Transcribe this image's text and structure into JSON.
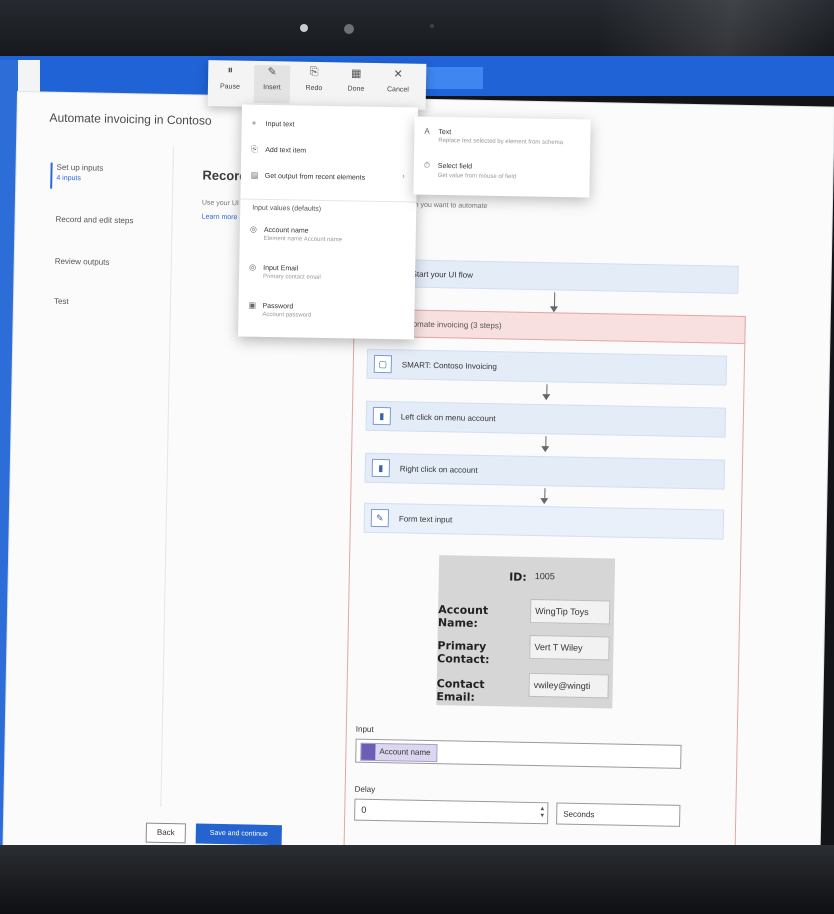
{
  "app": {
    "title": "Automate invoicing in Contoso"
  },
  "steps": [
    {
      "label": "Set up inputs",
      "sub": "4 inputs"
    },
    {
      "label": "Record and edit steps",
      "sub": ""
    },
    {
      "label": "Review outputs",
      "sub": ""
    },
    {
      "label": "Test",
      "sub": ""
    }
  ],
  "main": {
    "heading": "Record a",
    "description": "Use your UI",
    "learn_more": "Learn more",
    "description_tail": "action you want to automate"
  },
  "toolbar": [
    {
      "icon": "⏸",
      "label": "Pause"
    },
    {
      "icon": "✎",
      "label": "Insert"
    },
    {
      "icon": "⎘",
      "label": "Redo"
    },
    {
      "icon": "▦",
      "label": "Done"
    },
    {
      "icon": "✕",
      "label": "Cancel"
    }
  ],
  "menu": {
    "items": [
      {
        "icon": "+",
        "label": "Input text"
      },
      {
        "icon": "⎘",
        "label": "Add text item"
      },
      {
        "icon": "▤",
        "label": "Get output from recent elements"
      }
    ],
    "section": "Input values (defaults)",
    "inputs": [
      {
        "label": "Account name",
        "sub": "Element name Account name"
      },
      {
        "label": "Input Email",
        "sub": "Primary contact email"
      },
      {
        "label": "Password",
        "sub": "Account password"
      }
    ]
  },
  "submenu": [
    {
      "icon": "A",
      "label": "Text",
      "sub": "Replace text selected by element from schema"
    },
    {
      "icon": "⏱",
      "label": "Select field",
      "sub": "Get value from mouse of field"
    }
  ],
  "flow": {
    "start": "Start your UI flow",
    "group": "Automate invoicing (3 steps)",
    "steps": [
      {
        "icon": "▢",
        "label": "SMART: Contoso Invoicing"
      },
      {
        "icon": "▮",
        "label": "Left click on menu account"
      },
      {
        "icon": "▮",
        "label": "Right click on account"
      },
      {
        "icon": "✎",
        "label": "Form text input"
      }
    ]
  },
  "preview": {
    "rows": [
      {
        "label": "ID:",
        "value": "1005"
      },
      {
        "label": "Account Name:",
        "value": "WingTip Toys"
      },
      {
        "label": "Primary Contact:",
        "value": "Vert T Wiley"
      },
      {
        "label": "Contact Email:",
        "value": "vwiley@wingti"
      }
    ]
  },
  "input": {
    "label": "Input",
    "token": "Account name",
    "delay_label": "Delay",
    "delay_value": "0",
    "unit": "Seconds"
  },
  "buttons": {
    "back": "Back",
    "save": "Save and continue"
  },
  "colors": {
    "accent": "#2564d0",
    "group_border": "#e2a7a4",
    "flow_fill": "#e4ecf8"
  }
}
